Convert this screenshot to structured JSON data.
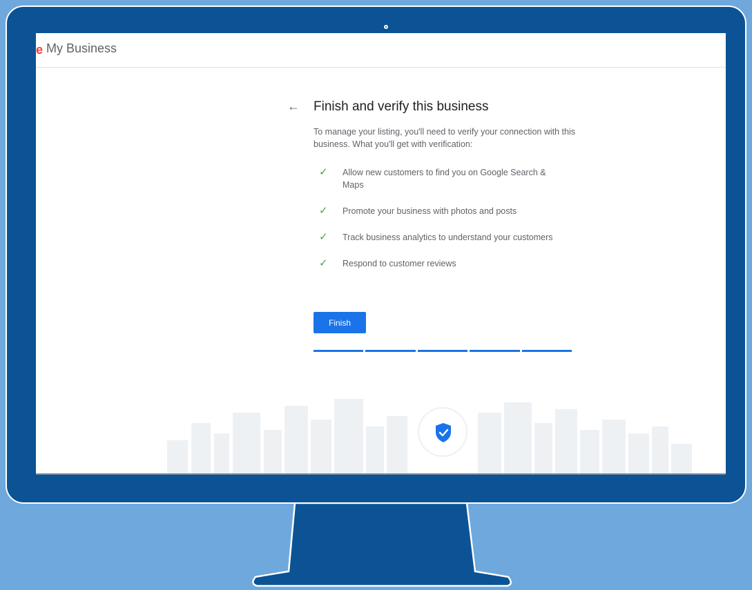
{
  "header": {
    "logo_letter": "e",
    "app_name": "My Business"
  },
  "main": {
    "back_icon": "arrow-left-icon",
    "title": "Finish and verify this business",
    "intro": "To manage your listing, you'll need to verify your connection with this business. What you'll get with verification:",
    "benefits": [
      "Allow new customers to find you on Google Search & Maps",
      "Promote your business with photos and posts",
      "Track business analytics to understand your customers",
      "Respond to customer reviews"
    ],
    "finish_label": "Finish",
    "progress_steps_completed": 5,
    "progress_steps_total": 5
  },
  "colors": {
    "monitor": "#0b5394",
    "background": "#6fa8dc",
    "accent": "#1a73e8",
    "check": "#34a853"
  }
}
